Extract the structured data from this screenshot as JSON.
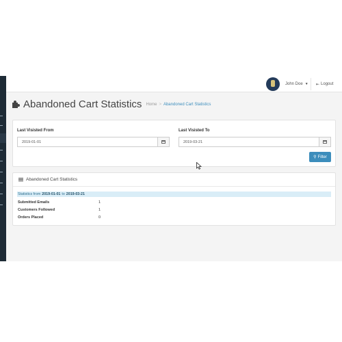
{
  "topbar": {
    "user_name": "John Doe",
    "logout_label": "Logout"
  },
  "page": {
    "title": "Abandoned Cart Statistics",
    "breadcrumb": {
      "home": "Home",
      "separator": ">",
      "current": "Abandoned Cart Statistics"
    }
  },
  "filters": {
    "from": {
      "label": "Last Visisted From",
      "value": "2019-01-01"
    },
    "to": {
      "label": "Last Visisted To",
      "value": "2019-03-21"
    },
    "button_label": "Filter"
  },
  "stats": {
    "panel_title": "Abandoned Cart Statistics",
    "range": {
      "prefix": "Statistics from",
      "start": "2019-01-01",
      "joiner": "to",
      "end": "2019-03-21"
    },
    "rows": [
      {
        "label": "Submitted Emails",
        "value": "1"
      },
      {
        "label": "Customers Followed",
        "value": "1"
      },
      {
        "label": "Orders Placed",
        "value": "0"
      }
    ]
  },
  "colors": {
    "primary": "#3c8dbc",
    "sidebar": "#1e2b36",
    "info_bg": "#d9edf7"
  },
  "icons": [
    "puzzle-icon",
    "calendar-icon",
    "search-icon",
    "list-icon",
    "logout-icon",
    "caret-down-icon",
    "user-avatar"
  ]
}
